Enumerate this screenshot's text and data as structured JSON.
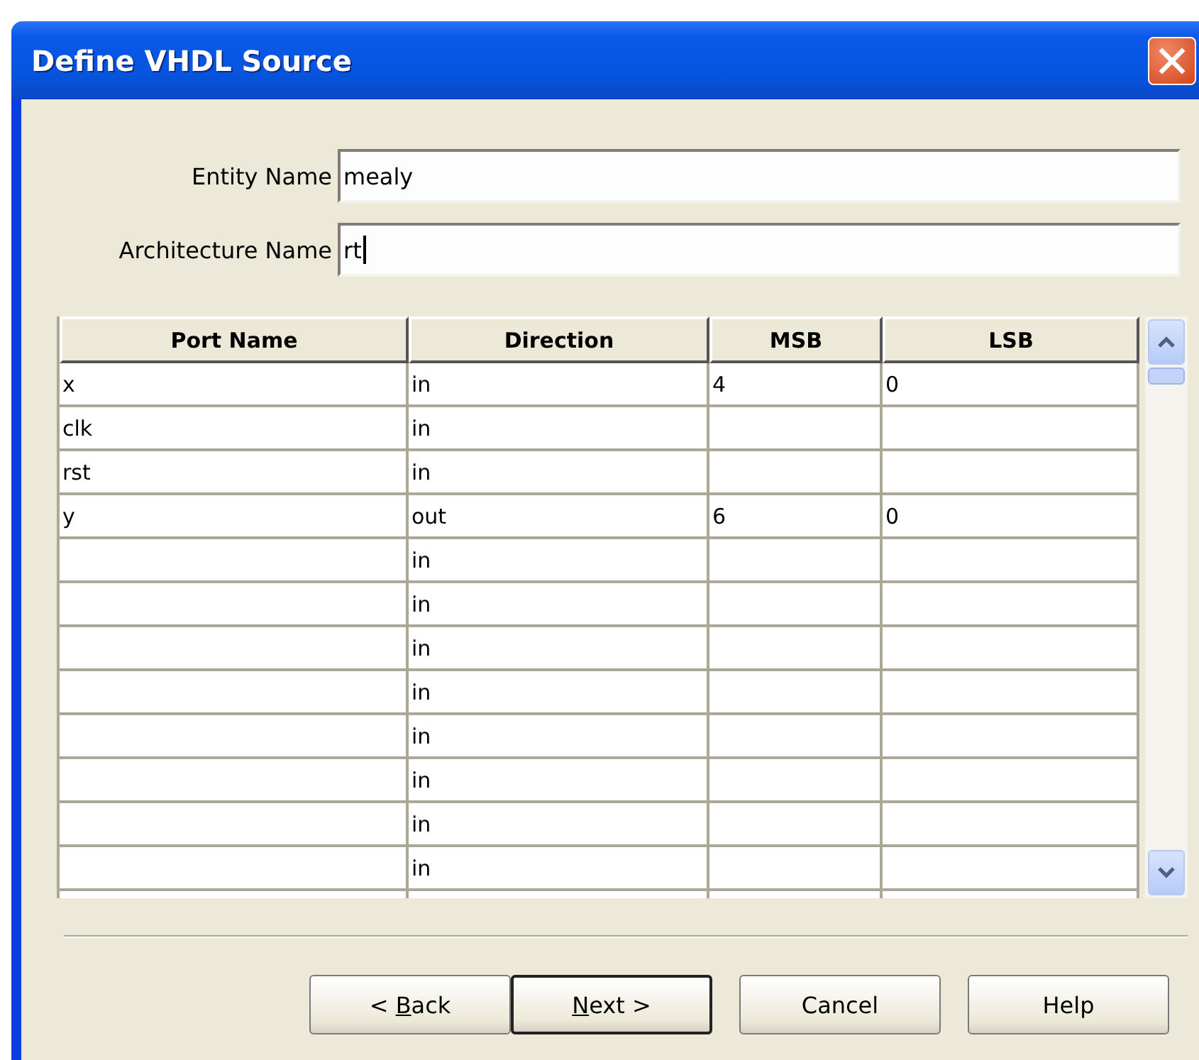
{
  "window": {
    "title": "Define VHDL Source"
  },
  "fields": [
    {
      "label": "Entity Name",
      "value": "mealy",
      "focused": false
    },
    {
      "label": "Architecture Name",
      "value": "rt",
      "focused": true
    }
  ],
  "table": {
    "columns": [
      "Port Name",
      "Direction",
      "MSB",
      "LSB"
    ],
    "rows": [
      [
        "x",
        "in",
        "4",
        "0"
      ],
      [
        "clk",
        "in",
        "",
        ""
      ],
      [
        "rst",
        "in",
        "",
        ""
      ],
      [
        "y",
        "out",
        "6",
        "0"
      ],
      [
        "",
        "in",
        "",
        ""
      ],
      [
        "",
        "in",
        "",
        ""
      ],
      [
        "",
        "in",
        "",
        ""
      ],
      [
        "",
        "in",
        "",
        ""
      ],
      [
        "",
        "in",
        "",
        ""
      ],
      [
        "",
        "in",
        "",
        ""
      ],
      [
        "",
        "in",
        "",
        ""
      ],
      [
        "",
        "in",
        "",
        ""
      ]
    ]
  },
  "buttons": [
    {
      "label": "< ",
      "mnemonic": "B",
      "label_rest": "ack",
      "default": false
    },
    {
      "mnemonic": "N",
      "label_rest": "ext >",
      "default": true
    },
    {
      "label": "Cancel",
      "default": false
    },
    {
      "label": "Help",
      "default": false
    }
  ]
}
